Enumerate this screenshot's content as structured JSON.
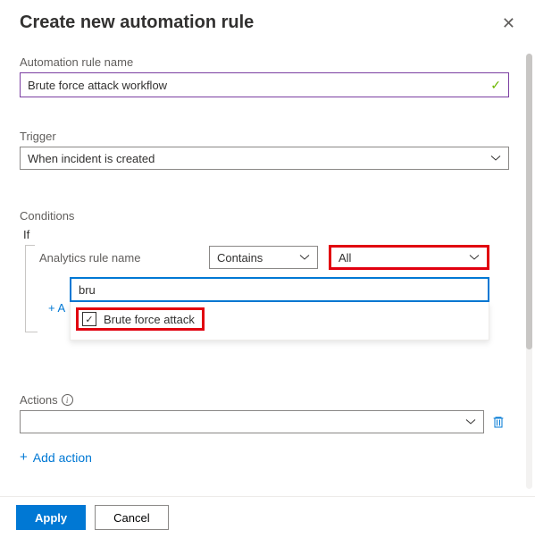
{
  "header": {
    "title": "Create new automation rule"
  },
  "ruleName": {
    "label": "Automation rule name",
    "value": "Brute force attack workflow"
  },
  "trigger": {
    "label": "Trigger",
    "value": "When incident is created"
  },
  "conditions": {
    "label": "Conditions",
    "if": "If",
    "fieldLabel": "Analytics rule name",
    "operator": "Contains",
    "valueLabel": "All",
    "searchValue": "bru",
    "option": "Brute force attack",
    "addLink": "+ A"
  },
  "actions": {
    "label": "Actions",
    "addAction": "Add action"
  },
  "footer": {
    "apply": "Apply",
    "cancel": "Cancel"
  }
}
